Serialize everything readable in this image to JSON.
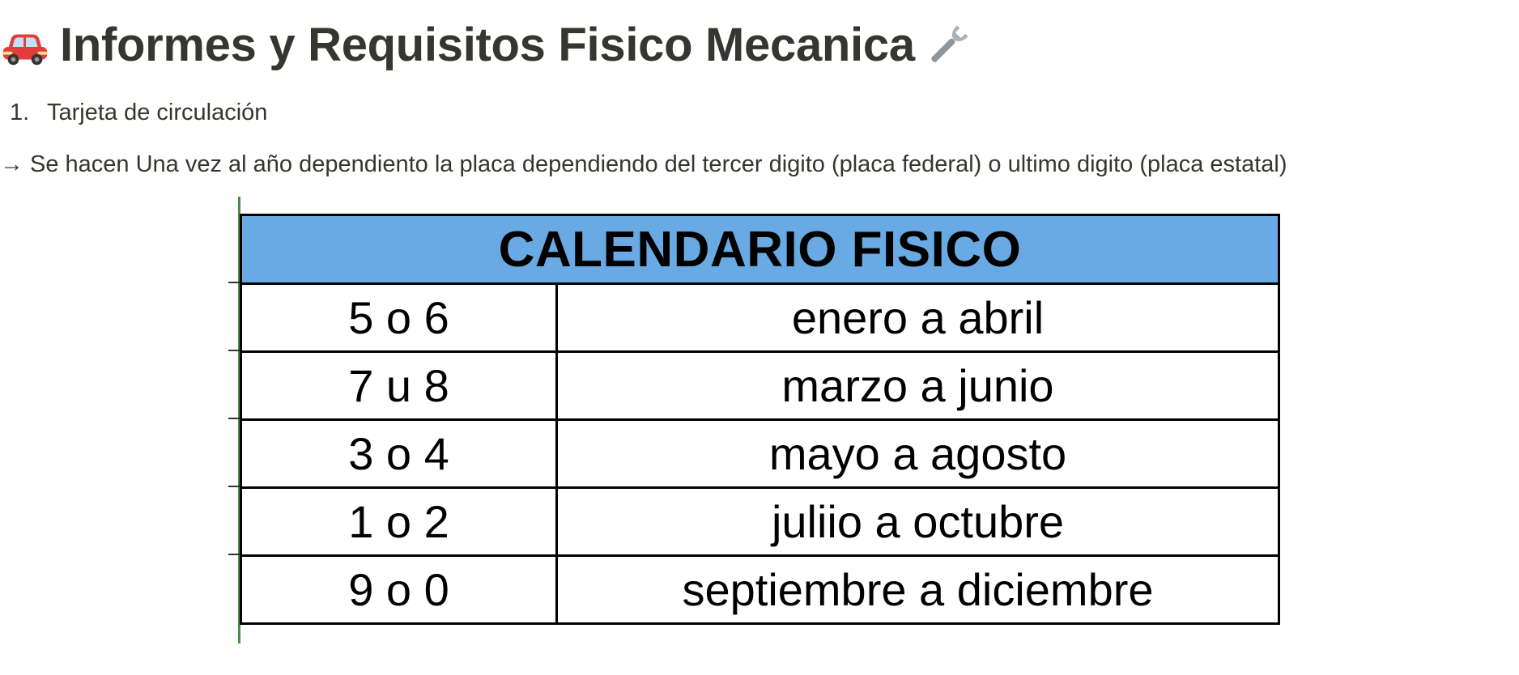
{
  "header": {
    "title": "Informes y Requisitos Fisico Mecanica",
    "leading_icon": "car-icon",
    "trailing_icon": "wrench-icon"
  },
  "list": {
    "items": [
      {
        "number": "1.",
        "label": "Tarjeta de circulación"
      }
    ]
  },
  "paragraph": {
    "arrow": "→",
    "text": "Se hacen Una vez al año dependiento la placa dependiendo del tercer digito (placa federal) o ultimo digito (placa estatal)"
  },
  "calendar": {
    "title": "CALENDARIO FISICO",
    "header_color": "#6aaae4",
    "rows": [
      {
        "digits": "5 o 6",
        "months": "enero a abril"
      },
      {
        "digits": "7 u 8",
        "months": "marzo a junio"
      },
      {
        "digits": "3 o 4",
        "months": "mayo a agosto"
      },
      {
        "digits": "1 o 2",
        "months": "juliio a octubre"
      },
      {
        "digits": "9 o 0",
        "months": "septiembre a diciembre"
      }
    ]
  }
}
